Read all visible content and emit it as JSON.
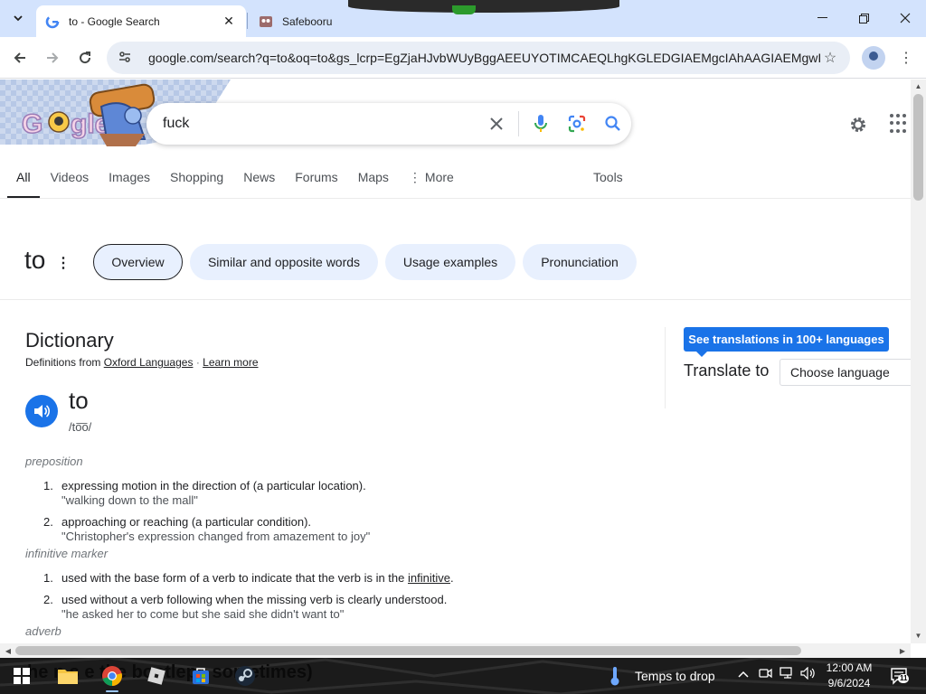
{
  "browser": {
    "tabs": [
      {
        "title": "to - Google Search",
        "active": true
      },
      {
        "title": "Safebooru",
        "active": false
      }
    ],
    "url": "google.com/search?q=to&oq=to&gs_lcrp=EgZjaHJvbWUyBggAEEUYOTIMCAEQLhgKGLEDGIAEMgcIAhAAGIAEMgwIA..."
  },
  "search": {
    "query": "fuck",
    "tabs": [
      "All",
      "Videos",
      "Images",
      "Shopping",
      "News",
      "Forums",
      "Maps",
      "More"
    ],
    "tools_label": "Tools"
  },
  "topic": {
    "word": "to",
    "chips": [
      "Overview",
      "Similar and opposite words",
      "Usage examples",
      "Pronunciation"
    ]
  },
  "dictionary": {
    "title": "Dictionary",
    "source_prefix": "Definitions from",
    "source_name": "Oxford Languages",
    "learn_more": "Learn more",
    "headword": "to",
    "phonetic": "/to͞o/",
    "sections": [
      {
        "pos": "preposition",
        "defs": [
          {
            "num": "1.",
            "text": "expressing motion in the direction of (a particular location).",
            "example": "\"walking down to the mall\""
          },
          {
            "num": "2.",
            "text": "approaching or reaching (a particular condition).",
            "example": "\"Christopher's expression changed from amazement to joy\""
          }
        ]
      },
      {
        "pos": "infinitive marker",
        "defs": [
          {
            "num": "1.",
            "text_before": "used with the base form of a verb to indicate that the verb is in the ",
            "link": "infinitive",
            "text_after": "."
          },
          {
            "num": "2.",
            "text": "used without a verb following when the missing verb is clearly understood.",
            "example": "\"he asked her to come but she said she didn't want to\""
          }
        ]
      },
      {
        "pos": "adverb",
        "defs": []
      }
    ]
  },
  "translate": {
    "button": "See translations in 100+ languages",
    "label": "Translate to",
    "select": "Choose language"
  },
  "taskbar": {
    "wallpaper_text": "he n s e the bootleps sometimes)",
    "weather": "Temps to drop",
    "time": "12:00 AM",
    "date": "9/6/2024",
    "notif_count": "11"
  },
  "colors": {
    "accent": "#1a73e8",
    "tabstrip": "#d3e3fd",
    "chip": "#e8f0fe"
  }
}
